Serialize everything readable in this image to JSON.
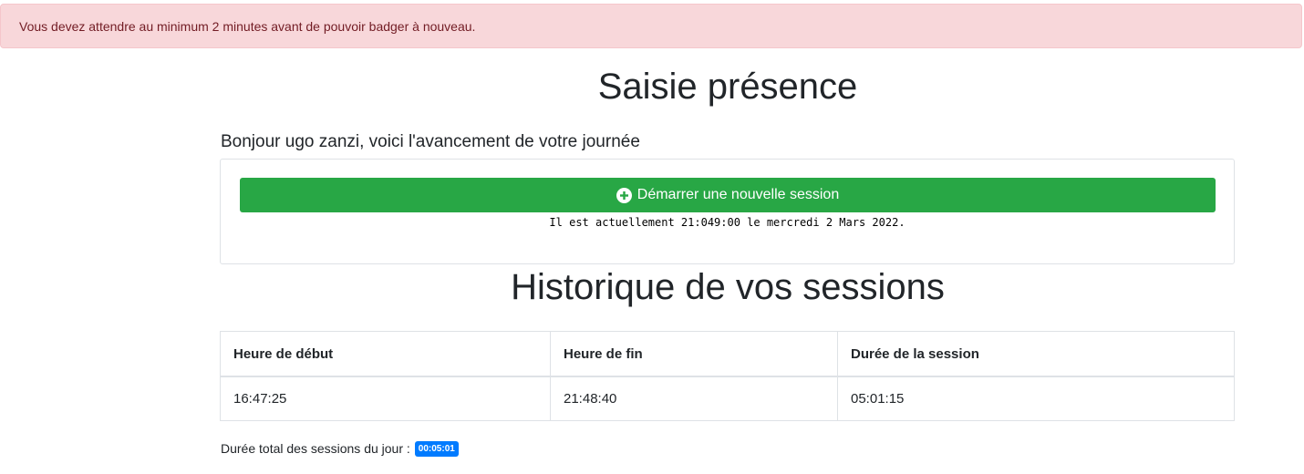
{
  "alert": {
    "message": "Vous devez attendre au minimum 2 minutes avant de pouvoir badger à nouveau."
  },
  "page": {
    "title": "Saisie présence",
    "greeting": "Bonjour ugo zanzi, voici l'avancement de votre journée"
  },
  "session_card": {
    "start_button_label": "Démarrer une nouvelle session",
    "start_button_icon": "plus-circle-icon",
    "clock_text": "Il est actuellement 21:049:00 le mercredi 2 Mars 2022."
  },
  "history": {
    "title": "Historique de vos sessions",
    "columns": [
      "Heure de début",
      "Heure de fin",
      "Durée de la session"
    ],
    "rows": [
      [
        "16:47:25",
        "21:48:40",
        "05:01:15"
      ]
    ]
  },
  "total": {
    "label": "Durée total des sessions du jour :",
    "value": "00:05:01"
  },
  "colors": {
    "alert_bg": "#f8d7da",
    "alert_text": "#721c24",
    "button_green": "#28a745",
    "badge_blue": "#007bff"
  }
}
